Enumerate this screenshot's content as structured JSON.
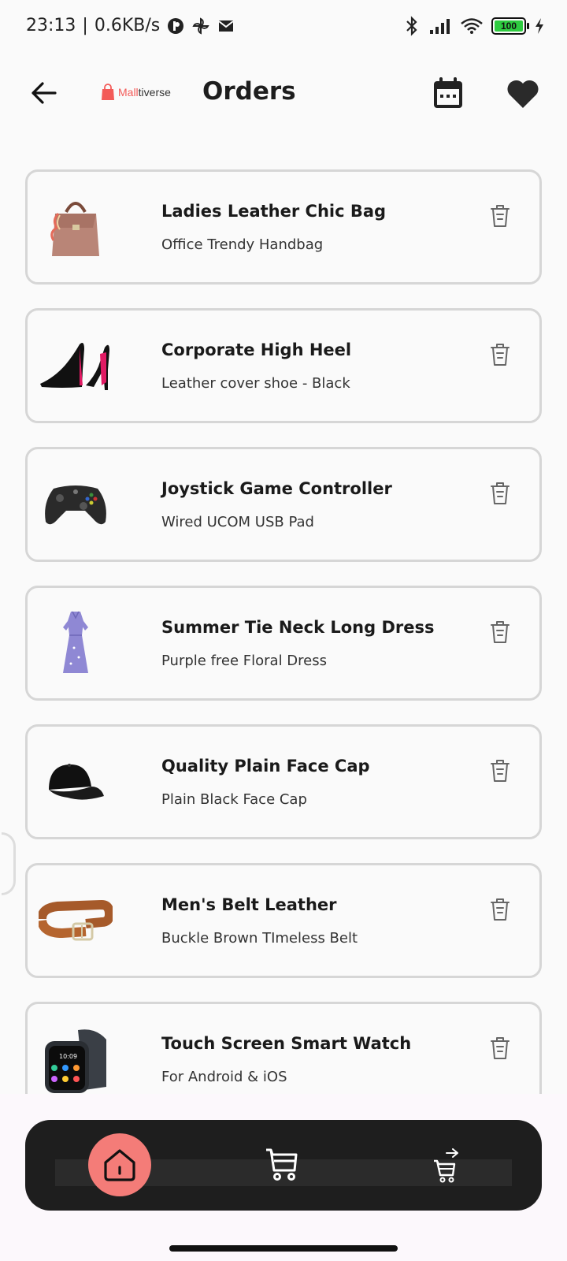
{
  "status_bar": {
    "time": "23:13",
    "network_speed": "0.6KB/s",
    "battery_level": "100"
  },
  "header": {
    "brand_part1": "Mall",
    "brand_part2": "tiverse",
    "title": "Orders"
  },
  "orders": [
    {
      "title": "Ladies Leather Chic Bag",
      "subtitle": "Office Trendy Handbag",
      "thumb": "handbag-image"
    },
    {
      "title": "Corporate High Heel",
      "subtitle": "Leather cover shoe - Black",
      "thumb": "high-heel-image"
    },
    {
      "title": "Joystick Game Controller",
      "subtitle": "Wired UCOM USB Pad",
      "thumb": "game-controller-image"
    },
    {
      "title": "Summer Tie Neck Long Dress",
      "subtitle": "Purple free Floral Dress",
      "thumb": "dress-image"
    },
    {
      "title": "Quality Plain Face Cap",
      "subtitle": "Plain Black Face Cap",
      "thumb": "cap-image"
    },
    {
      "title": "Men's Belt Leather",
      "subtitle": "Buckle Brown TImeless Belt",
      "thumb": "belt-image"
    },
    {
      "title": "Touch Screen Smart Watch",
      "subtitle": "For Android & iOS",
      "thumb": "smart-watch-image"
    }
  ],
  "colors": {
    "accent": "#f47c78",
    "brand": "#f35b58",
    "nav_background": "#1e1e1e",
    "card_border": "#d6d6d6"
  }
}
